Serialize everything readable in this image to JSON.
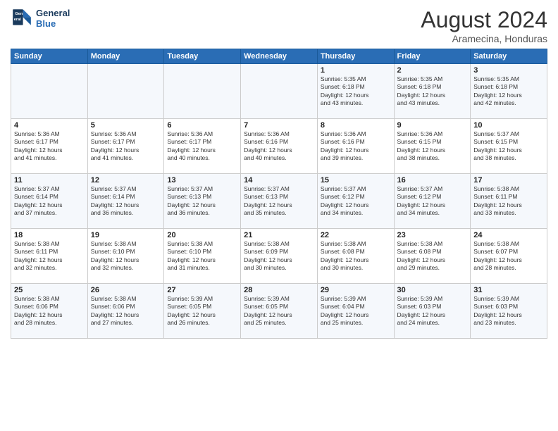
{
  "header": {
    "logo_line1": "General",
    "logo_line2": "Blue",
    "title": "August 2024",
    "subtitle": "Aramecina, Honduras"
  },
  "days_of_week": [
    "Sunday",
    "Monday",
    "Tuesday",
    "Wednesday",
    "Thursday",
    "Friday",
    "Saturday"
  ],
  "weeks": [
    [
      {
        "day": "",
        "info": ""
      },
      {
        "day": "",
        "info": ""
      },
      {
        "day": "",
        "info": ""
      },
      {
        "day": "",
        "info": ""
      },
      {
        "day": "1",
        "info": "Sunrise: 5:35 AM\nSunset: 6:18 PM\nDaylight: 12 hours\nand 43 minutes."
      },
      {
        "day": "2",
        "info": "Sunrise: 5:35 AM\nSunset: 6:18 PM\nDaylight: 12 hours\nand 43 minutes."
      },
      {
        "day": "3",
        "info": "Sunrise: 5:35 AM\nSunset: 6:18 PM\nDaylight: 12 hours\nand 42 minutes."
      }
    ],
    [
      {
        "day": "4",
        "info": "Sunrise: 5:36 AM\nSunset: 6:17 PM\nDaylight: 12 hours\nand 41 minutes."
      },
      {
        "day": "5",
        "info": "Sunrise: 5:36 AM\nSunset: 6:17 PM\nDaylight: 12 hours\nand 41 minutes."
      },
      {
        "day": "6",
        "info": "Sunrise: 5:36 AM\nSunset: 6:17 PM\nDaylight: 12 hours\nand 40 minutes."
      },
      {
        "day": "7",
        "info": "Sunrise: 5:36 AM\nSunset: 6:16 PM\nDaylight: 12 hours\nand 40 minutes."
      },
      {
        "day": "8",
        "info": "Sunrise: 5:36 AM\nSunset: 6:16 PM\nDaylight: 12 hours\nand 39 minutes."
      },
      {
        "day": "9",
        "info": "Sunrise: 5:36 AM\nSunset: 6:15 PM\nDaylight: 12 hours\nand 38 minutes."
      },
      {
        "day": "10",
        "info": "Sunrise: 5:37 AM\nSunset: 6:15 PM\nDaylight: 12 hours\nand 38 minutes."
      }
    ],
    [
      {
        "day": "11",
        "info": "Sunrise: 5:37 AM\nSunset: 6:14 PM\nDaylight: 12 hours\nand 37 minutes."
      },
      {
        "day": "12",
        "info": "Sunrise: 5:37 AM\nSunset: 6:14 PM\nDaylight: 12 hours\nand 36 minutes."
      },
      {
        "day": "13",
        "info": "Sunrise: 5:37 AM\nSunset: 6:13 PM\nDaylight: 12 hours\nand 36 minutes."
      },
      {
        "day": "14",
        "info": "Sunrise: 5:37 AM\nSunset: 6:13 PM\nDaylight: 12 hours\nand 35 minutes."
      },
      {
        "day": "15",
        "info": "Sunrise: 5:37 AM\nSunset: 6:12 PM\nDaylight: 12 hours\nand 34 minutes."
      },
      {
        "day": "16",
        "info": "Sunrise: 5:37 AM\nSunset: 6:12 PM\nDaylight: 12 hours\nand 34 minutes."
      },
      {
        "day": "17",
        "info": "Sunrise: 5:38 AM\nSunset: 6:11 PM\nDaylight: 12 hours\nand 33 minutes."
      }
    ],
    [
      {
        "day": "18",
        "info": "Sunrise: 5:38 AM\nSunset: 6:11 PM\nDaylight: 12 hours\nand 32 minutes."
      },
      {
        "day": "19",
        "info": "Sunrise: 5:38 AM\nSunset: 6:10 PM\nDaylight: 12 hours\nand 32 minutes."
      },
      {
        "day": "20",
        "info": "Sunrise: 5:38 AM\nSunset: 6:10 PM\nDaylight: 12 hours\nand 31 minutes."
      },
      {
        "day": "21",
        "info": "Sunrise: 5:38 AM\nSunset: 6:09 PM\nDaylight: 12 hours\nand 30 minutes."
      },
      {
        "day": "22",
        "info": "Sunrise: 5:38 AM\nSunset: 6:08 PM\nDaylight: 12 hours\nand 30 minutes."
      },
      {
        "day": "23",
        "info": "Sunrise: 5:38 AM\nSunset: 6:08 PM\nDaylight: 12 hours\nand 29 minutes."
      },
      {
        "day": "24",
        "info": "Sunrise: 5:38 AM\nSunset: 6:07 PM\nDaylight: 12 hours\nand 28 minutes."
      }
    ],
    [
      {
        "day": "25",
        "info": "Sunrise: 5:38 AM\nSunset: 6:06 PM\nDaylight: 12 hours\nand 28 minutes."
      },
      {
        "day": "26",
        "info": "Sunrise: 5:38 AM\nSunset: 6:06 PM\nDaylight: 12 hours\nand 27 minutes."
      },
      {
        "day": "27",
        "info": "Sunrise: 5:39 AM\nSunset: 6:05 PM\nDaylight: 12 hours\nand 26 minutes."
      },
      {
        "day": "28",
        "info": "Sunrise: 5:39 AM\nSunset: 6:05 PM\nDaylight: 12 hours\nand 25 minutes."
      },
      {
        "day": "29",
        "info": "Sunrise: 5:39 AM\nSunset: 6:04 PM\nDaylight: 12 hours\nand 25 minutes."
      },
      {
        "day": "30",
        "info": "Sunrise: 5:39 AM\nSunset: 6:03 PM\nDaylight: 12 hours\nand 24 minutes."
      },
      {
        "day": "31",
        "info": "Sunrise: 5:39 AM\nSunset: 6:03 PM\nDaylight: 12 hours\nand 23 minutes."
      }
    ]
  ]
}
